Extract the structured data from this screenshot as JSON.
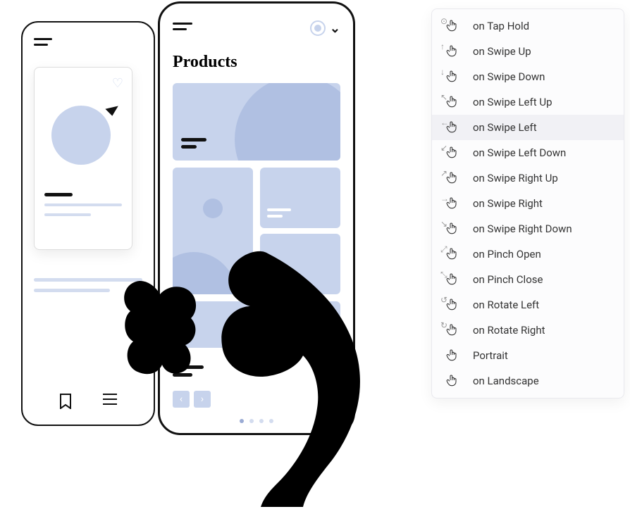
{
  "front_phone": {
    "title": "Products"
  },
  "gestures": {
    "items": [
      {
        "label": "on Tap Hold",
        "icon": "tap-hold"
      },
      {
        "label": "on Swipe Up",
        "icon": "swipe-up"
      },
      {
        "label": "on Swipe Down",
        "icon": "swipe-down"
      },
      {
        "label": "on Swipe Left Up",
        "icon": "swipe-left-up"
      },
      {
        "label": "on Swipe Left",
        "icon": "swipe-left"
      },
      {
        "label": "on Swipe Left Down",
        "icon": "swipe-left-down"
      },
      {
        "label": "on Swipe Right Up",
        "icon": "swipe-right-up"
      },
      {
        "label": "on Swipe Right",
        "icon": "swipe-right"
      },
      {
        "label": "on Swipe Right Down",
        "icon": "swipe-right-down"
      },
      {
        "label": "on Pinch Open",
        "icon": "pinch-open"
      },
      {
        "label": "on Pinch Close",
        "icon": "pinch-close"
      },
      {
        "label": "on Rotate Left",
        "icon": "rotate-left"
      },
      {
        "label": "on Rotate Right",
        "icon": "rotate-right"
      },
      {
        "label": "Portrait",
        "icon": "portrait"
      },
      {
        "label": "on Landscape",
        "icon": "landscape"
      }
    ],
    "selected_index": 4
  }
}
